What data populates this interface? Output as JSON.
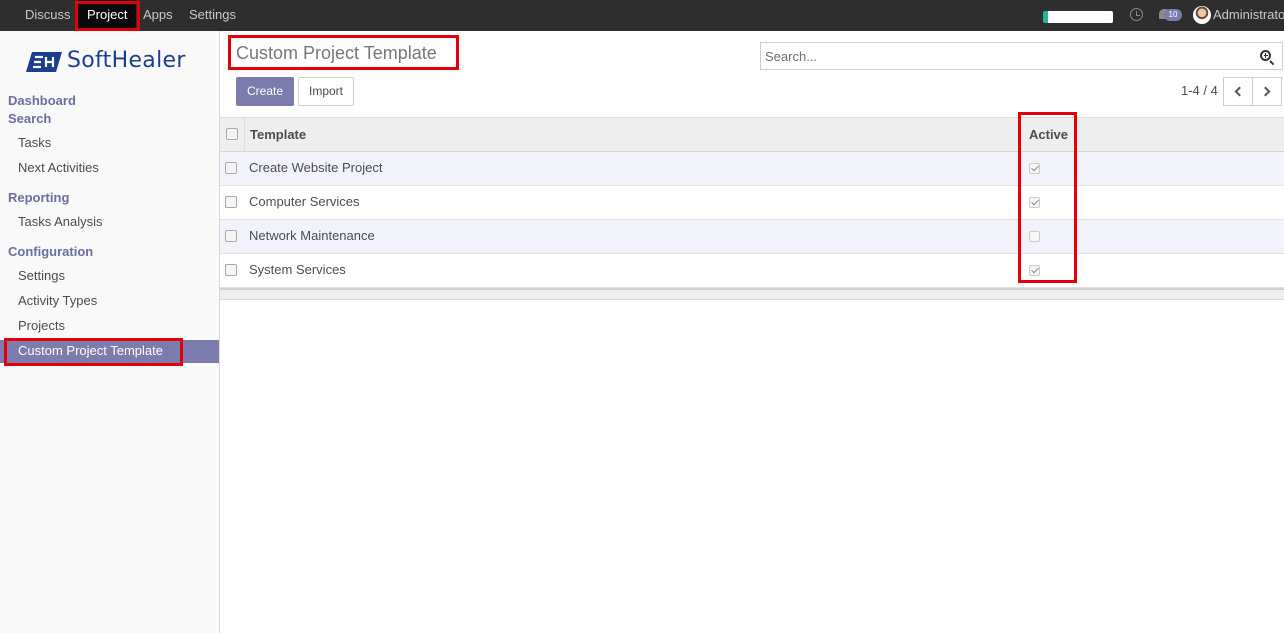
{
  "topbar": {
    "menus": [
      "Discuss",
      "Project",
      "Apps",
      "Settings"
    ],
    "active_menu": "Project",
    "chat_count": "10",
    "user_name": "Administrator"
  },
  "sidebar": {
    "logo_text": "SoftHealer",
    "sections": [
      {
        "title": "Dashboard",
        "items": []
      },
      {
        "title": "Search",
        "items": [
          "Tasks",
          "Next Activities"
        ]
      },
      {
        "title": "Reporting",
        "items": [
          "Tasks Analysis"
        ]
      },
      {
        "title": "Configuration",
        "items": [
          "Settings",
          "Activity Types",
          "Projects",
          "Custom Project Template"
        ]
      }
    ],
    "active_item": "Custom Project Template"
  },
  "control_panel": {
    "title": "Custom Project Template",
    "search_placeholder": "Search...",
    "create_label": "Create",
    "import_label": "Import",
    "pager": "1-4 / 4"
  },
  "table": {
    "columns": [
      "Template",
      "Active"
    ],
    "rows": [
      {
        "template": "Create Website Project",
        "active": true
      },
      {
        "template": "Computer Services",
        "active": true
      },
      {
        "template": "Network Maintenance",
        "active": false
      },
      {
        "template": "System Services",
        "active": true
      }
    ]
  },
  "colors": {
    "navbar": "#2e2e2e",
    "accent": "#7c7bad",
    "highlight": "#e0000a",
    "logo": "#1d3e8e"
  }
}
